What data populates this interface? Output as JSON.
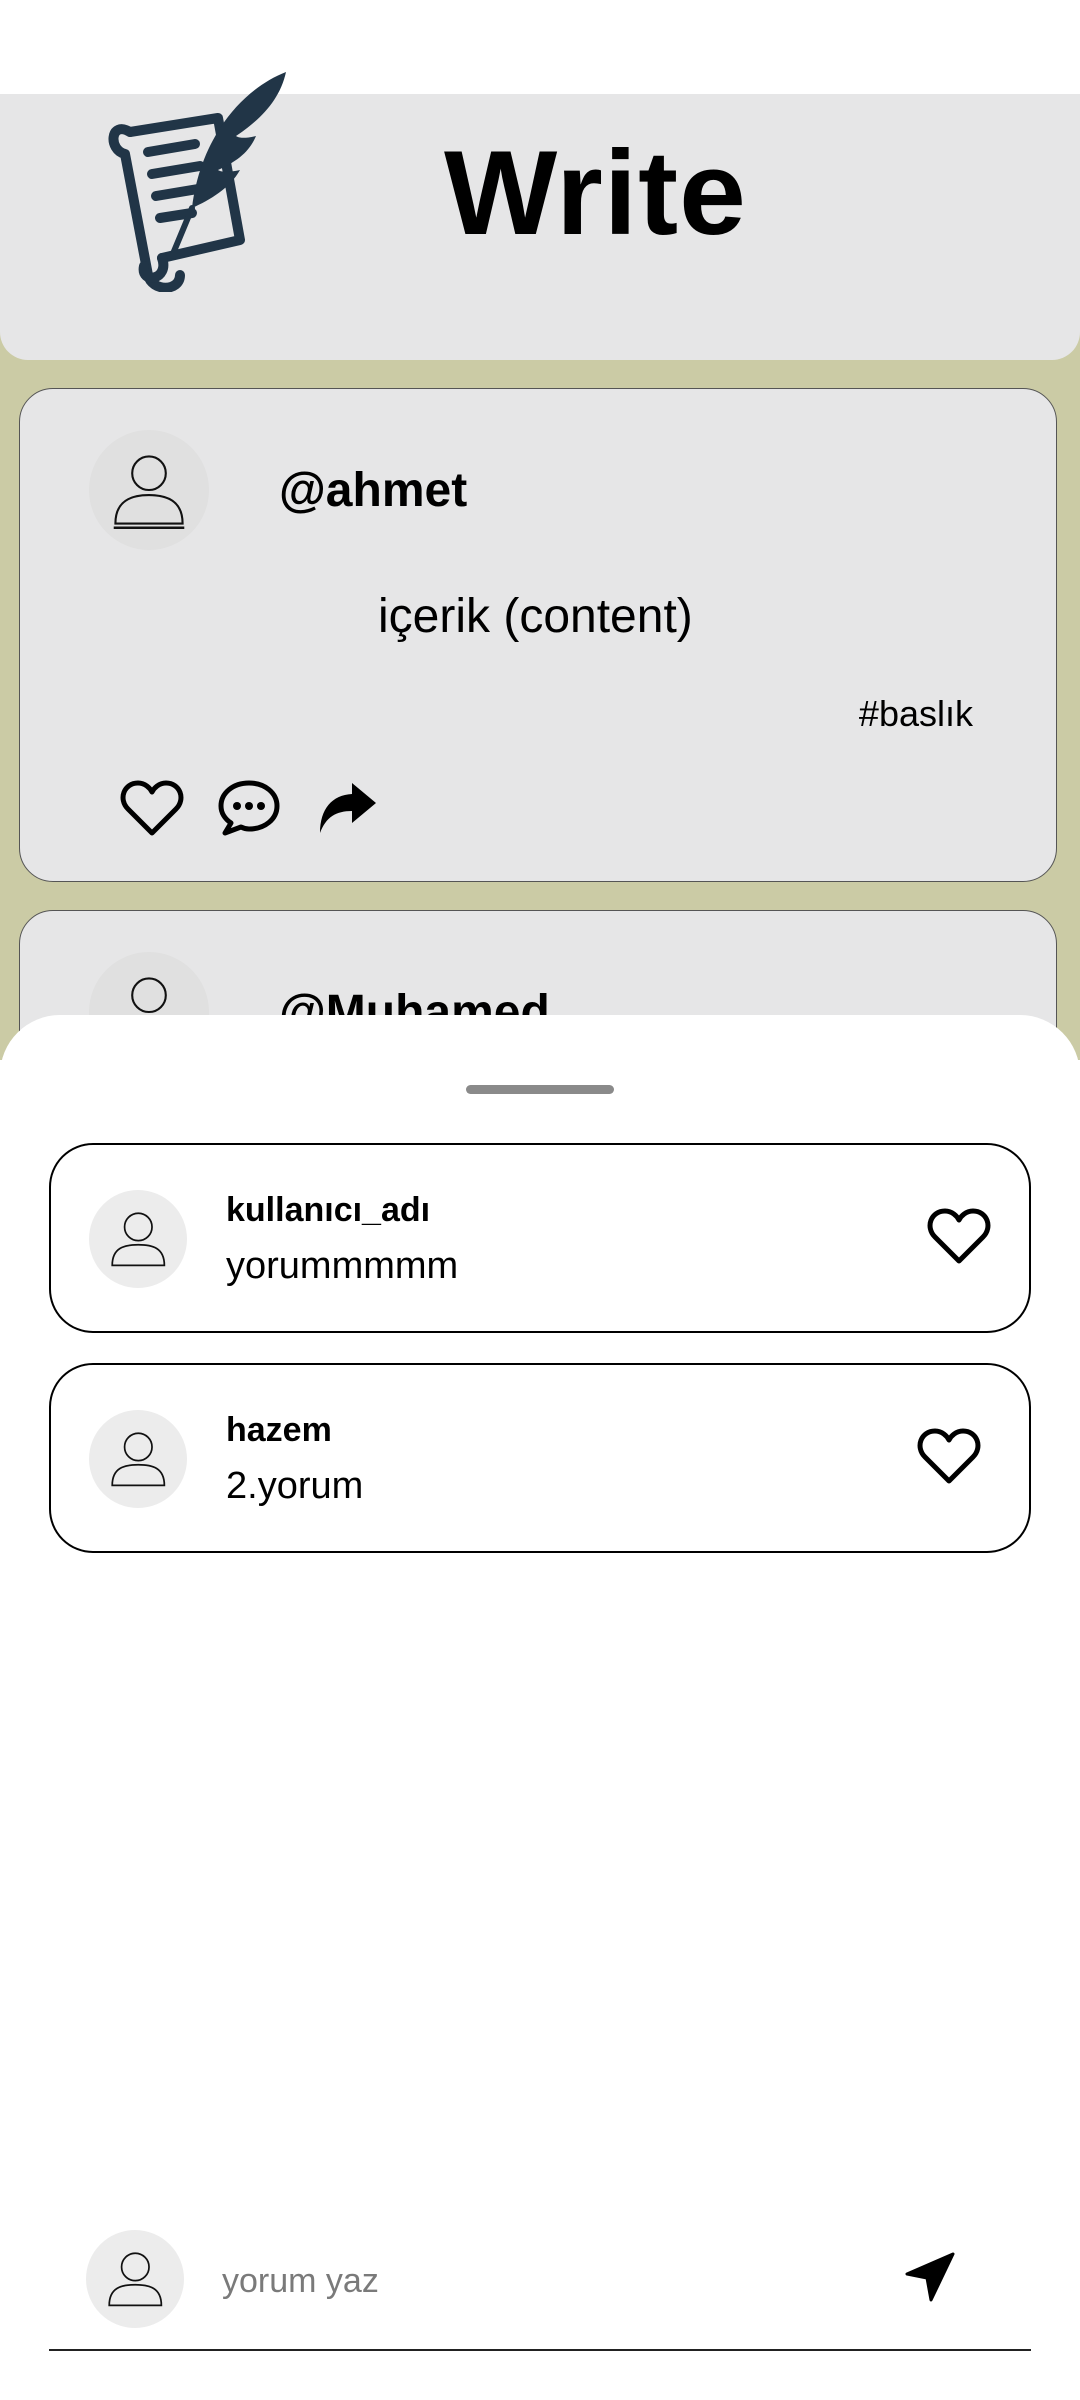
{
  "header": {
    "title": "Write",
    "logo_icon": "scroll-quill-icon"
  },
  "colors": {
    "background": "#cbcba5",
    "card": "#e6e6e7",
    "logo": "#213547"
  },
  "posts": [
    {
      "username": "@ahmet",
      "content": "içerik (content)",
      "tag": "#baslık",
      "actions": [
        "heart-icon",
        "comment-bubble-icon",
        "share-arrow-icon"
      ]
    },
    {
      "username": "@Muhamed"
    }
  ],
  "comments_sheet": {
    "comments": [
      {
        "user": "kullanıcı_adı",
        "text": "yorummmmm"
      },
      {
        "user": "hazem",
        "text": "2.yorum"
      }
    ],
    "composer": {
      "placeholder": "yorum yaz",
      "send_icon": "send-arrow-icon"
    }
  }
}
